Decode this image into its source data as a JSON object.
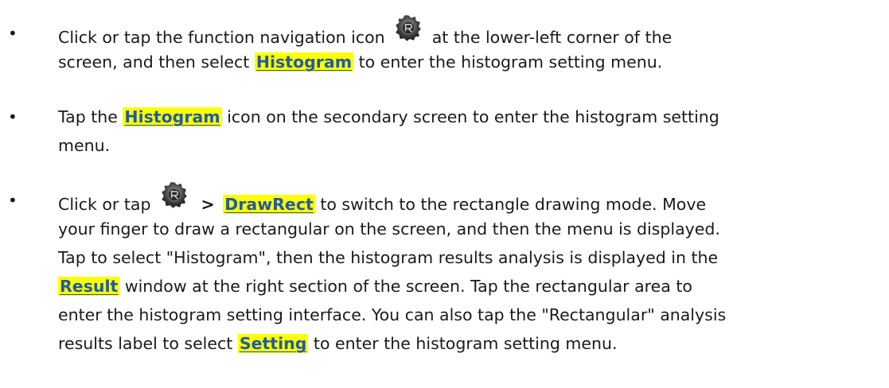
{
  "bullets": [
    {
      "marker": "•",
      "lines": [
        {
          "before_icon": "Click or tap the function navigation icon",
          "icon": "function-navigation-icon",
          "after_icon": "at the lower-left corner of the"
        },
        {
          "before_kw": "screen, and then select",
          "kw": "Histogram",
          "after_kw": "to enter the histogram setting menu."
        }
      ]
    },
    {
      "marker": "•",
      "lines": [
        {
          "before_kw": "Tap the",
          "kw": "Histogram",
          "after_kw": "icon on the secondary screen to enter the histogram setting"
        },
        {
          "text": "menu."
        }
      ]
    },
    {
      "marker": "•",
      "lines": [
        {
          "before_icon": "Click or tap",
          "icon": "function-navigation-icon",
          "arrow": ">",
          "kw": "DrawRect",
          "after_kw": "to switch to the rectangle drawing mode. Move"
        },
        {
          "text": "your finger to draw a rectangular on the screen, and then the menu is displayed."
        },
        {
          "text": "Tap to select \"Histogram\", then the histogram results analysis is displayed in the"
        },
        {
          "kw": "Result",
          "after_kw": "window at the right section of the screen. Tap the rectangular area to"
        },
        {
          "text": "enter the histogram setting interface. You can also tap the \"Rectangular\" analysis"
        },
        {
          "before_kw": "results label to select",
          "kw": "Setting",
          "after_kw": "to enter the histogram setting menu."
        }
      ]
    }
  ],
  "colors": {
    "highlight": "#ffff00",
    "keyword_text": "#1f5aa8",
    "body_text": "#1a1a1a"
  }
}
